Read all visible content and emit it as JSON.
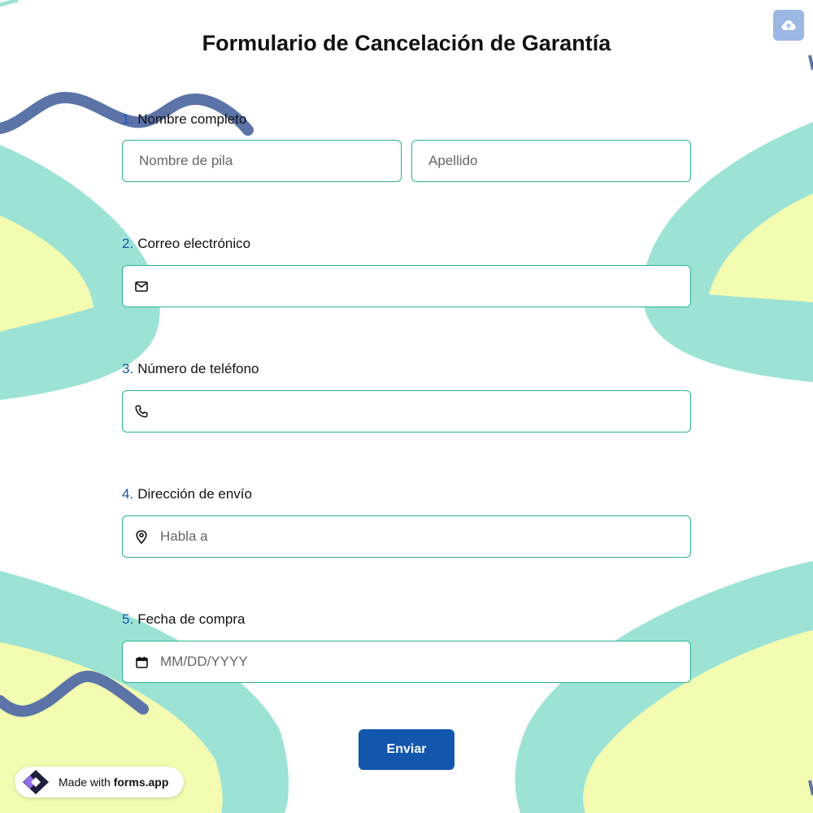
{
  "title": "Formulario de Cancelación de Garantía",
  "colors": {
    "accent": "#1257ad",
    "field_border": "#2bb394",
    "teal_blob": "#9ce3d6",
    "yellow_blob": "#f2fbb0",
    "squiggle": "#5c73a8"
  },
  "questions": [
    {
      "number": "1.",
      "label": "Nombre completo",
      "first_name_placeholder": "Nombre de pila",
      "last_name_placeholder": "Apellido"
    },
    {
      "number": "2.",
      "label": "Correo electrónico",
      "icon": "envelope-icon",
      "value": ""
    },
    {
      "number": "3.",
      "label": "Número de teléfono",
      "icon": "phone-icon",
      "value": ""
    },
    {
      "number": "4.",
      "label": "Dirección de envío",
      "icon": "map-pin-icon",
      "placeholder": "Habla a"
    },
    {
      "number": "5.",
      "label": "Fecha de compra",
      "icon": "calendar-icon",
      "placeholder": "MM/DD/YYYY"
    }
  ],
  "submit_label": "Enviar",
  "upload_icon": "cloud-upload-icon",
  "badge": {
    "prefix": "Made with",
    "brand": "forms.app"
  }
}
